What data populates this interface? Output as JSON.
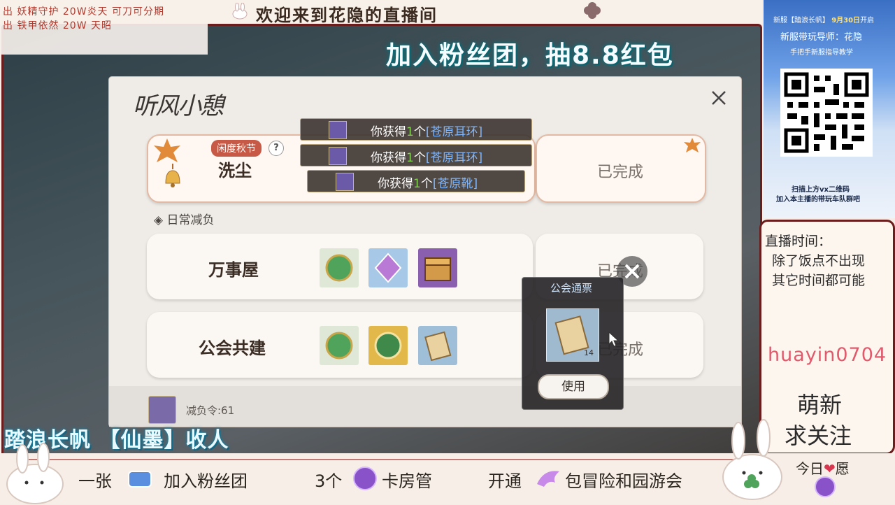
{
  "overlay": {
    "ticker_top": "出 妖精守护 20W炎天  可刀可分期",
    "welcome": "欢迎来到花隐的直播间",
    "ticker_second": "出 铁甲依然 20W 天昭",
    "fan_banner": "加入粉丝团，抽8.8红包",
    "recruit": "踏浪长帆 【仙墨】收人",
    "perks": [
      {
        "prefix": "一张",
        "text": "加入粉丝团"
      },
      {
        "prefix": "3个",
        "text": "卡房管"
      },
      {
        "prefix": "开通",
        "text": "包冒险和园游会"
      }
    ],
    "wish_prefix": "今日",
    "wish_heart": "❤",
    "wish_suffix": "愿"
  },
  "dialog": {
    "title": "听风小憩",
    "event_badge": "闲度秋节",
    "help": "?",
    "tasks": [
      {
        "name": "洗尘",
        "status": "已完成"
      },
      {
        "name": "万事屋",
        "status": "已完成"
      },
      {
        "name": "公会共建",
        "status": "已完成"
      }
    ],
    "section_label": "◈ 日常减负",
    "token_text": "减负令:61",
    "toasts": [
      {
        "prefix": "你获得",
        "num": "1",
        "unit": "个",
        "item": "[苍原耳环]"
      },
      {
        "prefix": "你获得",
        "num": "1",
        "unit": "个",
        "item": "[苍原耳环]"
      },
      {
        "prefix": "你获得",
        "num": "1",
        "unit": "个",
        "item": "[苍原靴]"
      }
    ],
    "popup": {
      "title": "公会通票",
      "count": "14",
      "use_label": "使用"
    },
    "reward_icons": [
      "exp-orb-icon",
      "purple-crystal-icon",
      "treasure-chest-icon",
      "exp-orb-icon",
      "contribution-badge-icon",
      "guild-pass-icon"
    ]
  },
  "sidebar": {
    "ad": {
      "server_prefix": "新服【踏浪长帆】",
      "date": "9月30日",
      "open": "开启",
      "mentor": "新服带玩导师：花隐",
      "tutorial": "手把手新服指导教学",
      "scan1": "扫描上方vx二维码",
      "scan2": "加入本主播的带玩车队群吧"
    },
    "live_title": "直播时间：",
    "live_l1": "除了饭点不出现",
    "live_l2": "其它时间都可能",
    "handle": "huayin0704",
    "moe": "萌新",
    "follow": "求关注"
  },
  "colors": {
    "accent_red": "#6b1d1d",
    "handle_pink": "#e05a6c",
    "toast_num": "#7fd34a",
    "toast_item": "#7fb7ff"
  }
}
